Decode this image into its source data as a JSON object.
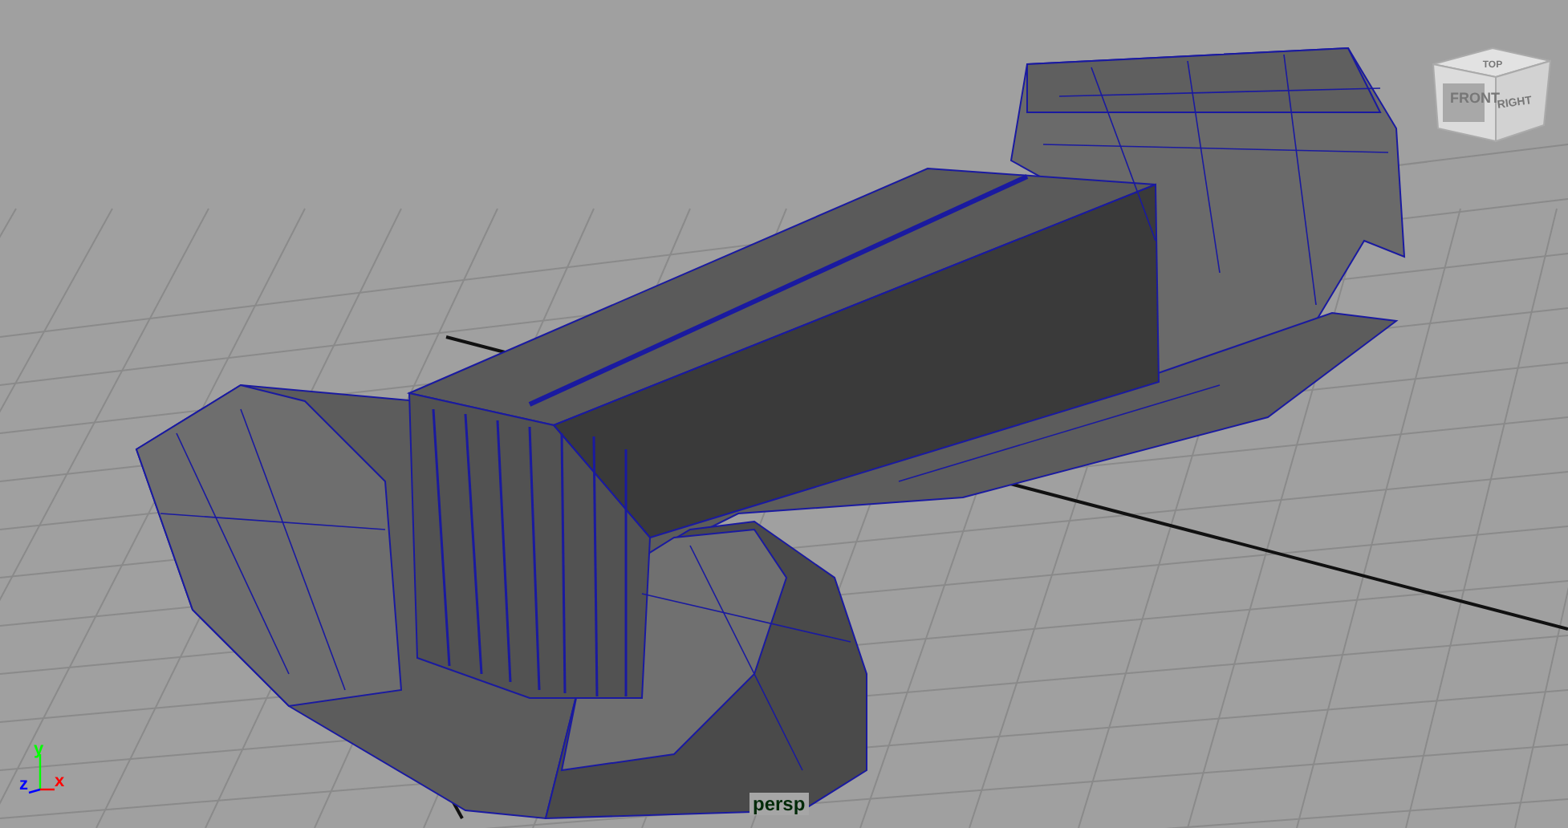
{
  "viewport": {
    "camera_label": "persp"
  },
  "view_cube": {
    "faces": [
      {
        "kind": "top",
        "label": "TOP"
      },
      {
        "kind": "front",
        "label": "FRONT"
      },
      {
        "kind": "right",
        "label": "RIGHT"
      }
    ]
  },
  "axis_gizmo": {
    "axes": [
      {
        "kind": "y",
        "label": "y",
        "color": "#00ff00"
      },
      {
        "kind": "z",
        "label": "z",
        "color": "#0000ff"
      },
      {
        "kind": "x",
        "label": "x",
        "color": "#ff0000"
      }
    ]
  }
}
